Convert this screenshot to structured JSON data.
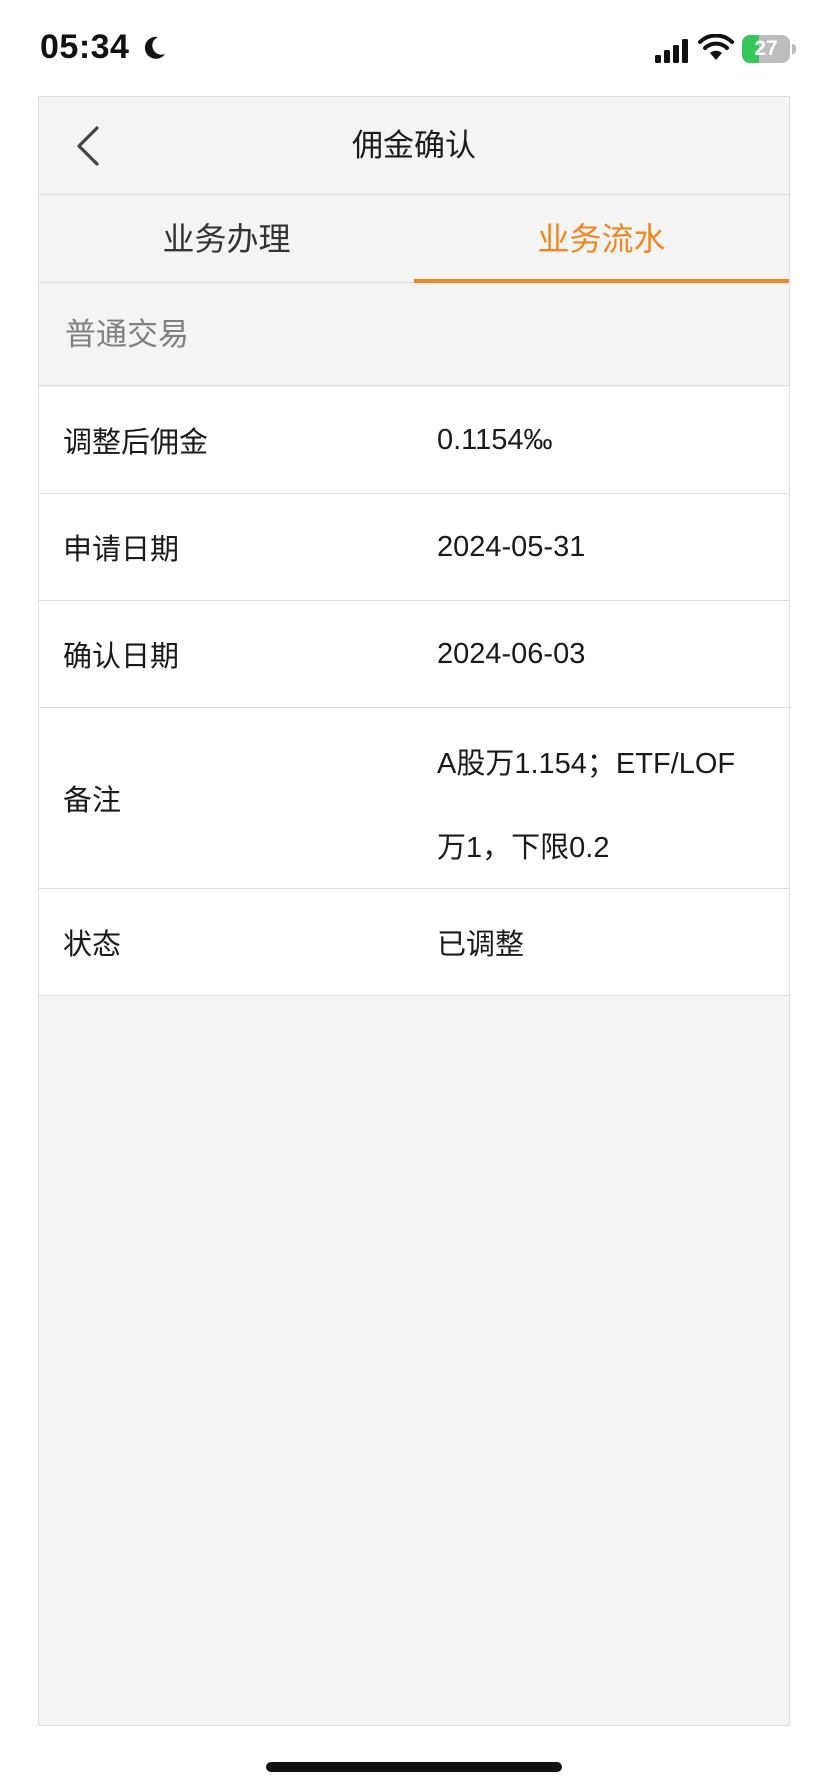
{
  "status_bar": {
    "time": "05:34",
    "battery_level": "27",
    "icons": [
      "moon-icon",
      "signal-icon",
      "wifi-icon",
      "battery-icon"
    ]
  },
  "navbar": {
    "title": "佣金确认",
    "back_icon": "chevron-left-icon"
  },
  "tabs": [
    {
      "label": "业务办理",
      "active": false
    },
    {
      "label": "业务流水",
      "active": true
    }
  ],
  "section": {
    "title": "普通交易"
  },
  "rows": [
    {
      "label": "调整后佣金",
      "value": "0.1154‰"
    },
    {
      "label": "申请日期",
      "value": "2024-05-31"
    },
    {
      "label": "确认日期",
      "value": "2024-06-03"
    },
    {
      "label": "备注",
      "value_line1": "A股万1.154；ETF/LOF",
      "value_line2": "万1，下限0.2"
    },
    {
      "label": "状态",
      "value": "已调整"
    }
  ],
  "colors": {
    "accent": "#f0871e",
    "background": "#f4f4f4",
    "row_background": "#ffffff",
    "divider": "#dddddd",
    "battery_green": "#34c759"
  }
}
